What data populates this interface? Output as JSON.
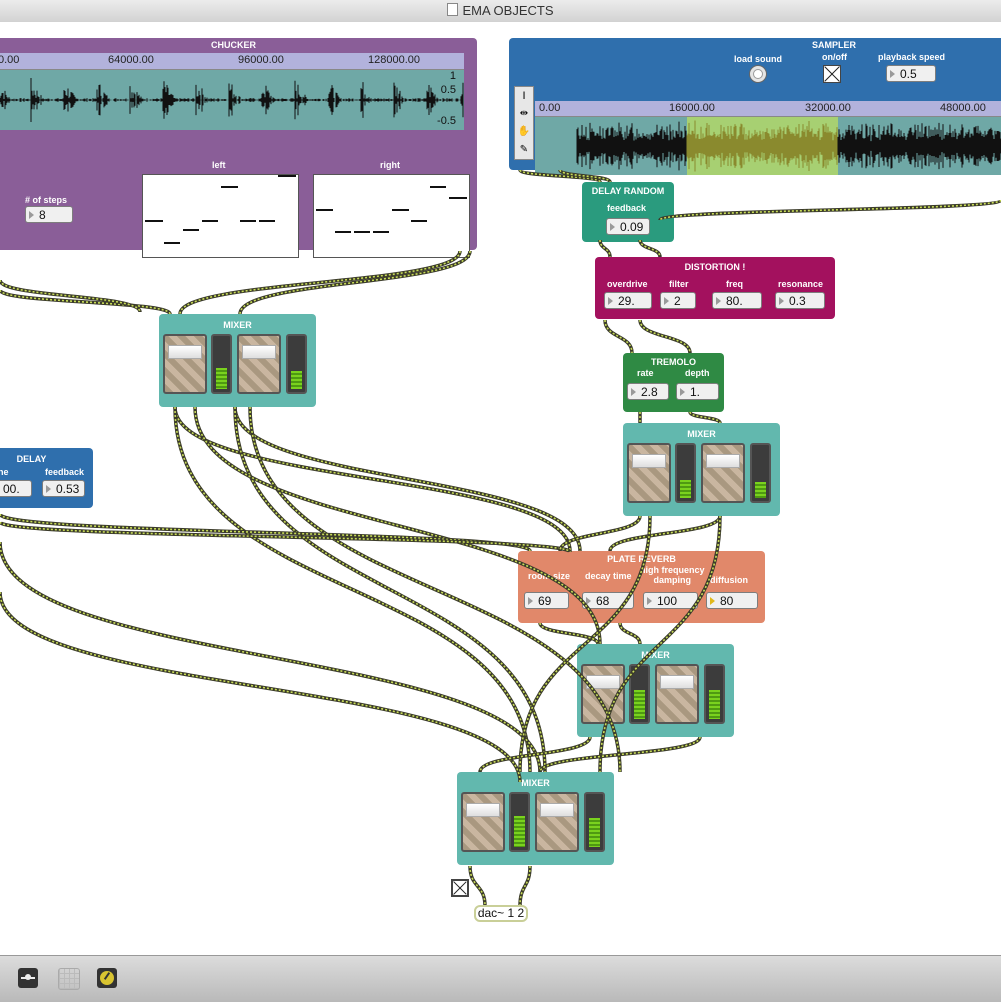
{
  "window": {
    "title": "EMA OBJECTS"
  },
  "chucker": {
    "title": "CHUCKER",
    "ruler": [
      "0.00",
      "64000.00",
      "96000.00",
      "128000.00"
    ],
    "amp_labels": [
      "1",
      "0.5",
      "-0.5"
    ],
    "steps_label": "# of steps",
    "steps_value": "8",
    "left_label": "left",
    "right_label": "right"
  },
  "sampler": {
    "title": "SAMPLER",
    "load_label": "load sound",
    "onoff_label": "on/off",
    "speed_label": "playback speed",
    "speed_value": "0.5",
    "ruler": [
      "0.00",
      "16000.00",
      "32000.00",
      "48000.00"
    ]
  },
  "delay_random": {
    "title": "DELAY RANDOM",
    "feedback_label": "feedback",
    "feedback_value": "0.09"
  },
  "distortion": {
    "title": "DISTORTION !",
    "overdrive_label": "overdrive",
    "overdrive_value": "29.",
    "filter_label": "filter",
    "filter_value": "2",
    "freq_label": "freq",
    "freq_value": "80.",
    "resonance_label": "resonance",
    "resonance_value": "0.3"
  },
  "tremolo": {
    "title": "TREMOLO",
    "rate_label": "rate",
    "rate_value": "2.8",
    "depth_label": "depth",
    "depth_value": "1."
  },
  "delay": {
    "title": "DELAY",
    "time_label": "ne",
    "time_value": "00.",
    "feedback_label": "feedback",
    "feedback_value": "0.53"
  },
  "reverb": {
    "title": "PLATE REVERB",
    "room_label": "room size",
    "room_value": "69",
    "decay_label": "decay time",
    "decay_value": "68",
    "hfd_label": "high frequency\ndamping",
    "hfd_value": "100",
    "diffusion_label": "diffusion",
    "diffusion_value": "80"
  },
  "mixers": [
    {
      "title": "MIXER",
      "levels": [
        0.4,
        0.35
      ]
    },
    {
      "title": "MIXER",
      "levels": [
        0.35,
        0.3
      ]
    },
    {
      "title": "MIXER",
      "levels": [
        0.55,
        0.55
      ]
    },
    {
      "title": "MIXER",
      "levels": [
        0.6,
        0.55
      ]
    }
  ],
  "dac": {
    "label": "dac~ 1 2"
  },
  "bottom_toolbar": {
    "icons": [
      "presentation-toggle-icon",
      "grid-icon",
      "dsp-power-icon"
    ]
  },
  "colors": {
    "chucker": "#8a5e98",
    "sampler": "#2f6fad",
    "delay_random": "#2a9b7e",
    "distortion": "#a3115e",
    "tremolo": "#2f8a44",
    "mixer": "#62b8ae",
    "reverb": "#e1886a",
    "delay": "#2f6fad",
    "patch_cord": "#7a8a28"
  }
}
